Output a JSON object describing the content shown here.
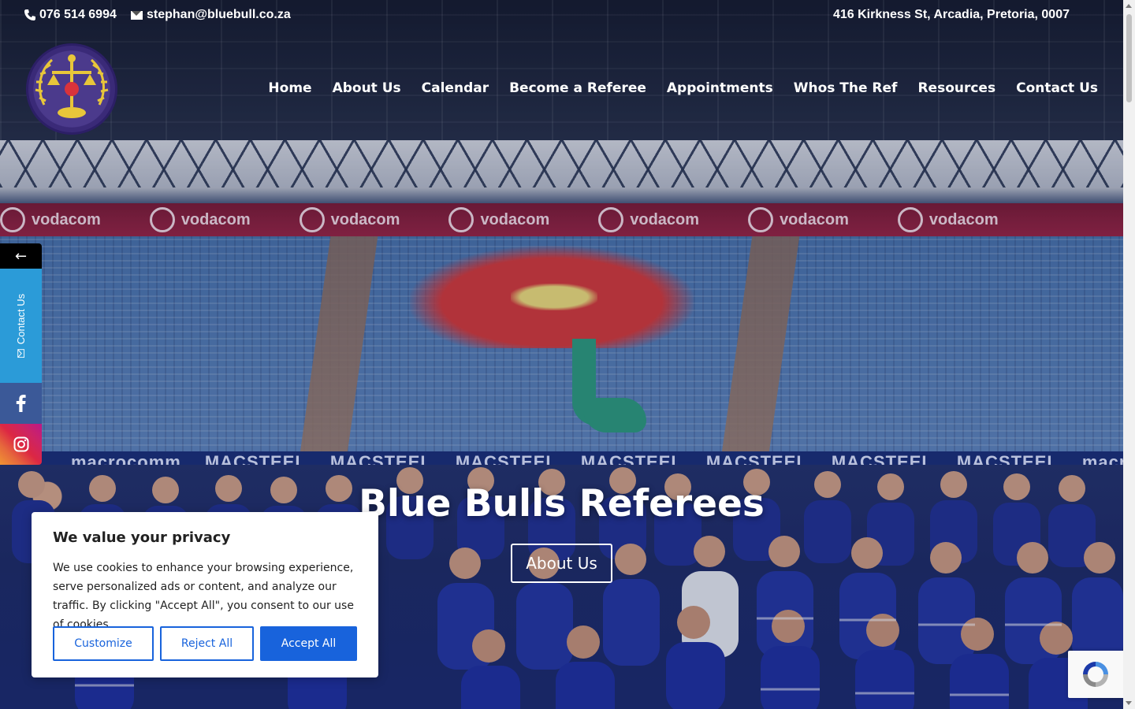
{
  "topbar": {
    "phone": "076 514 6994",
    "email": "stephan@bluebull.co.za",
    "address": "416 Kirkness St, Arcadia, Pretoria, 0007"
  },
  "nav": {
    "items": [
      {
        "label": "Home"
      },
      {
        "label": "About Us"
      },
      {
        "label": "Calendar"
      },
      {
        "label": "Become a Referee"
      },
      {
        "label": "Appointments"
      },
      {
        "label": "Whos The Ref"
      },
      {
        "label": "Resources"
      },
      {
        "label": "Contact Us"
      }
    ]
  },
  "hero": {
    "title": "Blue Bulls Referees",
    "button_label": "About Us",
    "banner_text": [
      "vodacom",
      "vodacom",
      "vodacom",
      "vodacom",
      "vodacom",
      "vodacom",
      "vodacom"
    ],
    "sponsor_text": [
      "macrocomm",
      "MACSTEEL",
      "MACSTEEL",
      "MACSTEEL",
      "MACSTEEL",
      "MACSTEEL",
      "MACSTEEL",
      "MACSTEEL",
      "macrocomm"
    ]
  },
  "side": {
    "toggle": "←",
    "contact_label": "Contact Us",
    "icons": [
      "facebook-icon",
      "instagram-icon"
    ]
  },
  "cookie": {
    "title": "We value your privacy",
    "text": "We use cookies to enhance your browsing experience, serve personalized ads or content, and analyze our traffic. By clicking \"Accept All\", you consent to our use of cookies.",
    "customize_label": "Customize",
    "reject_label": "Reject All",
    "accept_label": "Accept All"
  },
  "colors": {
    "accent": "#1863dc",
    "facebook": "#3b5998",
    "contact": "#2b9bd8"
  }
}
